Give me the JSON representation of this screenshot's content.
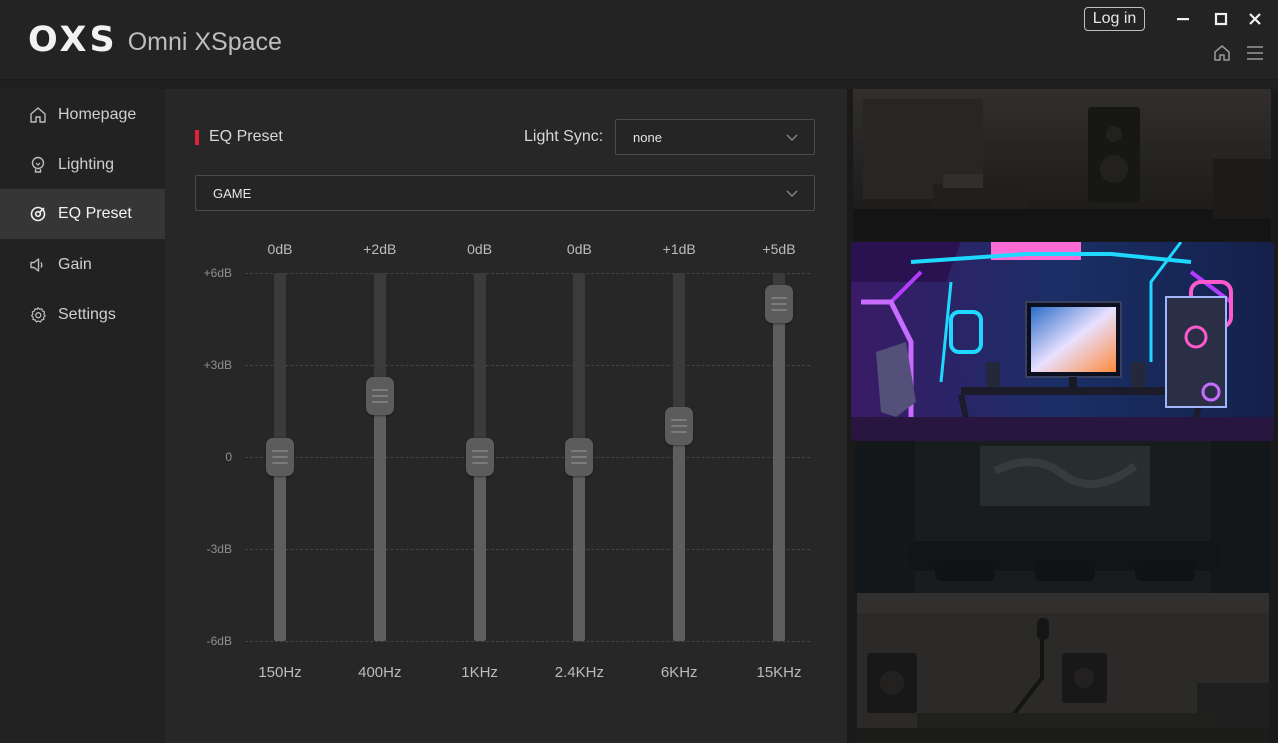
{
  "app": {
    "logo_mark": "OXS",
    "logo_text": "Omni XSpace",
    "login_label": "Log in"
  },
  "sidebar": {
    "items": [
      {
        "label": "Homepage",
        "icon": "home-icon",
        "active": false
      },
      {
        "label": "Lighting",
        "icon": "bulb-icon",
        "active": false
      },
      {
        "label": "EQ Preset",
        "icon": "eq-preset-icon",
        "active": true
      },
      {
        "label": "Gain",
        "icon": "speaker-icon",
        "active": false
      },
      {
        "label": "Settings",
        "icon": "gear-icon",
        "active": false
      }
    ]
  },
  "eq": {
    "title": "EQ Preset",
    "light_sync_label": "Light Sync:",
    "light_sync_value": "none",
    "preset_value": "GAME",
    "y_ticks": [
      "+6dB",
      "+3dB",
      "0",
      "-3dB",
      "-6dB"
    ],
    "bands": [
      {
        "freq": "150Hz",
        "gain_label": "0dB",
        "gain": 0
      },
      {
        "freq": "400Hz",
        "gain_label": "+2dB",
        "gain": 2
      },
      {
        "freq": "1KHz",
        "gain_label": "0dB",
        "gain": 0
      },
      {
        "freq": "2.4KHz",
        "gain_label": "0dB",
        "gain": 0
      },
      {
        "freq": "6KHz",
        "gain_label": "+1dB",
        "gain": 1
      },
      {
        "freq": "15KHz",
        "gain_label": "+5dB",
        "gain": 5
      }
    ],
    "gain_range": [
      -6,
      6
    ]
  },
  "gallery": {
    "scenes": [
      "living-room-scene",
      "gaming-room-scene",
      "home-theater-scene",
      "studio-scene"
    ],
    "selected": "gaming-room-scene"
  },
  "colors": {
    "accent": "#e0223a",
    "neon_cyan": "#1ed8ff",
    "neon_purple": "#b43cff"
  }
}
